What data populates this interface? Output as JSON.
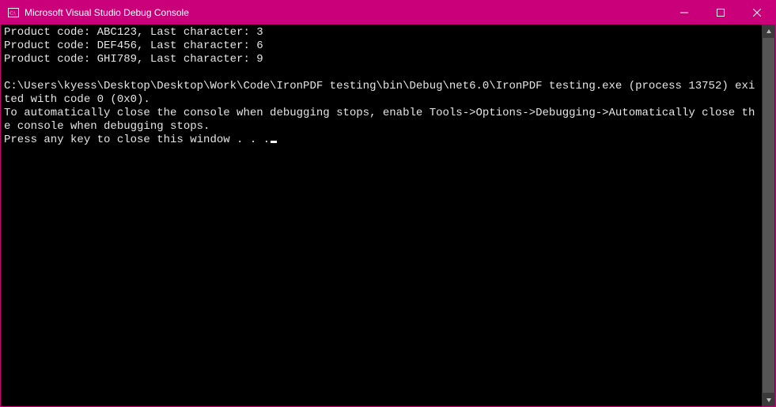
{
  "window": {
    "title": "Microsoft Visual Studio Debug Console"
  },
  "console": {
    "lines": [
      "Product code: ABC123, Last character: 3",
      "Product code: DEF456, Last character: 6",
      "Product code: GHI789, Last character: 9",
      "",
      "C:\\Users\\kyess\\Desktop\\Desktop\\Work\\Code\\IronPDF testing\\bin\\Debug\\net6.0\\IronPDF testing.exe (process 13752) exited with code 0 (0x0).",
      "To automatically close the console when debugging stops, enable Tools->Options->Debugging->Automatically close the console when debugging stops.",
      "Press any key to close this window . . ."
    ]
  }
}
